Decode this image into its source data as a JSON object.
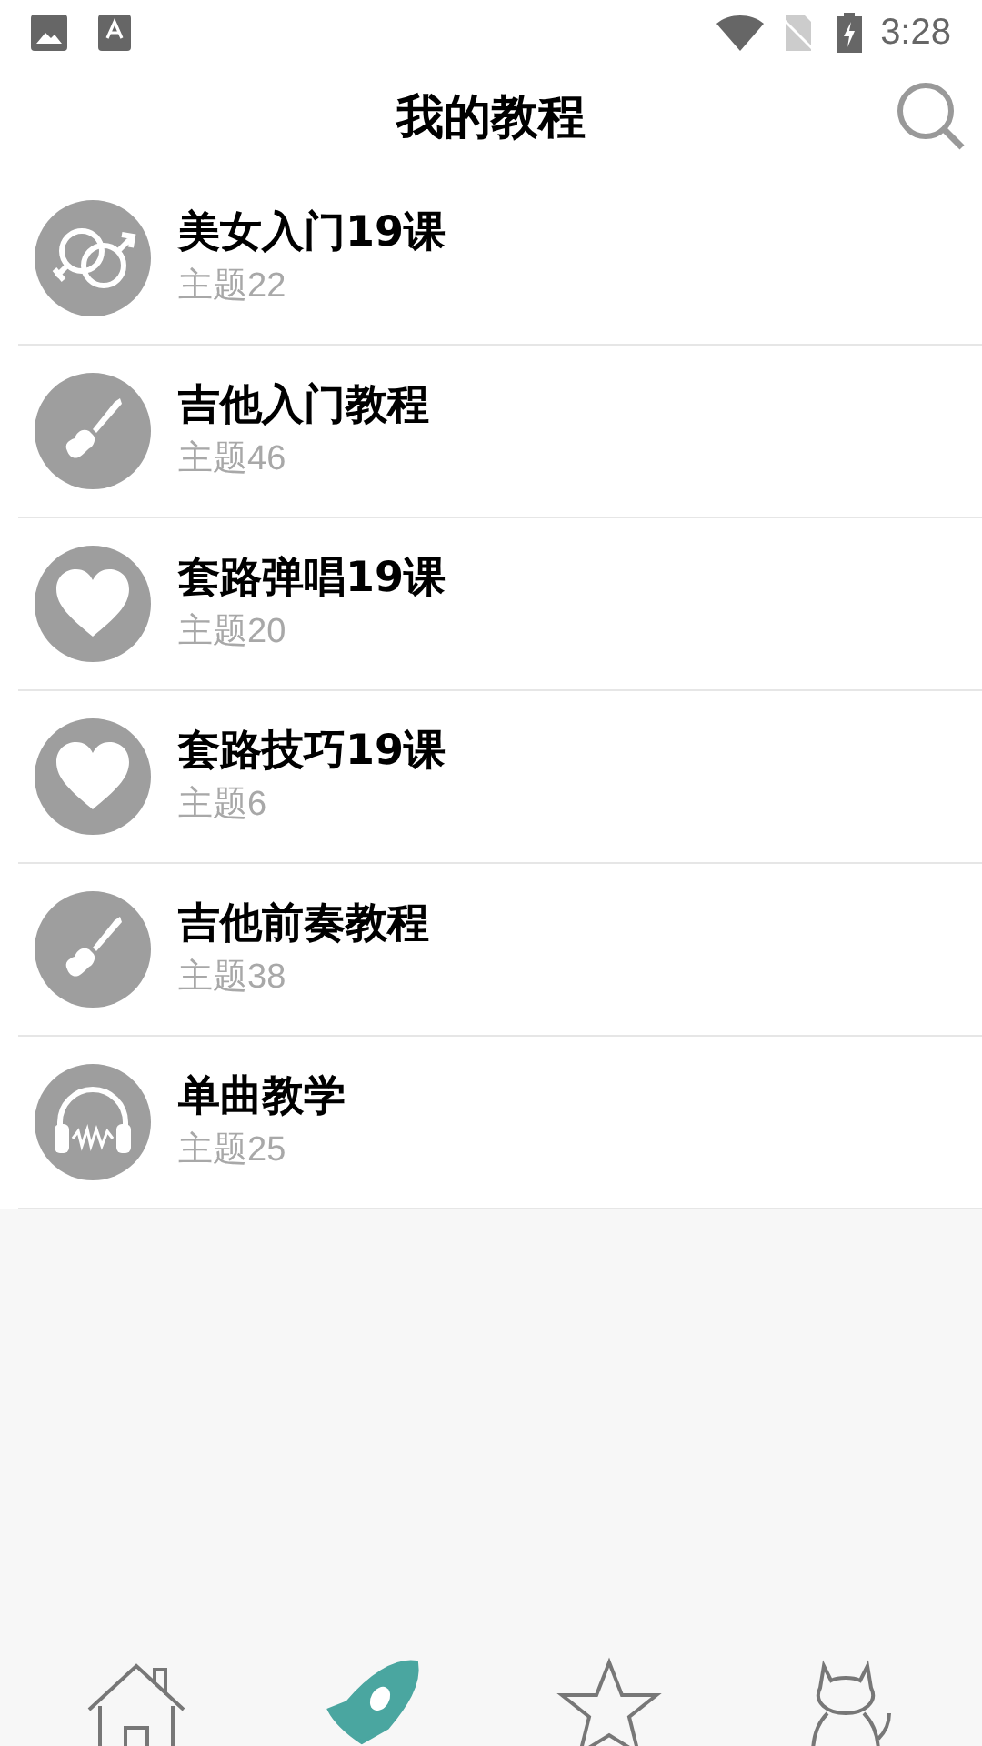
{
  "status_bar": {
    "time": "3:28"
  },
  "header": {
    "title": "我的教程"
  },
  "courses": [
    {
      "title": "美女入门19课",
      "subtitle": "主题22",
      "kind": "gender"
    },
    {
      "title": "吉他入门教程",
      "subtitle": "主题46",
      "kind": "guitar"
    },
    {
      "title": "套路弹唱19课",
      "subtitle": "主题20",
      "kind": "heart"
    },
    {
      "title": "套路技巧19课",
      "subtitle": "主题6",
      "kind": "heart"
    },
    {
      "title": "吉他前奏教程",
      "subtitle": "主题38",
      "kind": "guitar"
    },
    {
      "title": "单曲教学",
      "subtitle": "主题25",
      "kind": "headphones"
    }
  ],
  "bottom_nav": [
    {
      "kind": "home",
      "selected": false
    },
    {
      "kind": "rocket",
      "selected": true
    },
    {
      "kind": "star",
      "selected": false
    },
    {
      "kind": "cat",
      "selected": false
    }
  ]
}
